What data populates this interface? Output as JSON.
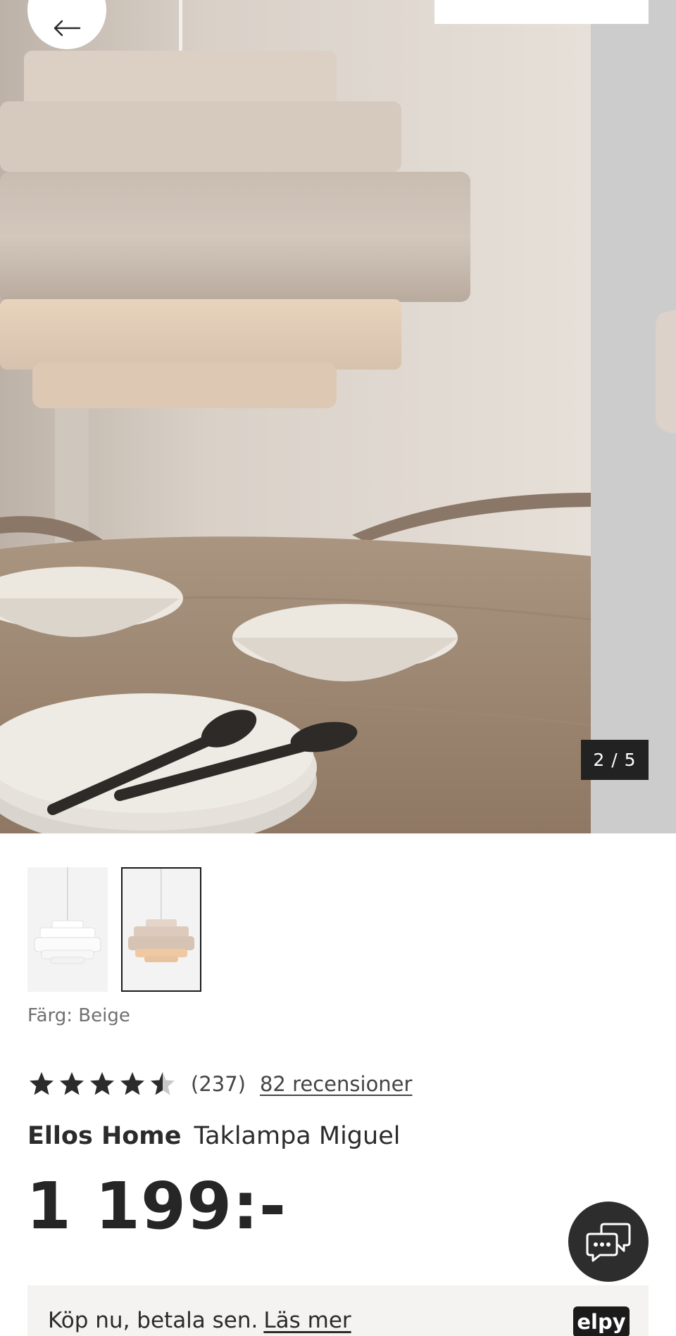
{
  "gallery": {
    "counter_text": "2 / 5",
    "current_index": 2,
    "total_images": 5,
    "back_icon": "arrow-left-icon"
  },
  "thumbnails": [
    {
      "color": "Vit",
      "active": false
    },
    {
      "color": "Beige",
      "active": true
    }
  ],
  "product": {
    "color_label": "Färg: Beige",
    "rating": 4.5,
    "rating_max": 5,
    "rating_count_text": "(237)",
    "reviews_link": "82 recensioner",
    "brand": "Ellos Home",
    "name": "Taklampa Miguel",
    "price": "1 199:-"
  },
  "chat": {
    "icon": "chat-bubbles-icon"
  },
  "payment": {
    "text": "Köp nu, betala sen.",
    "link": "Läs mer",
    "logo_text": "elpy"
  },
  "colors": {
    "dark": "#222222",
    "text": "#2b2b2b",
    "muted": "#707070",
    "banner_bg": "#f4f3f1",
    "lamp_beige": "#d8ccc2"
  }
}
